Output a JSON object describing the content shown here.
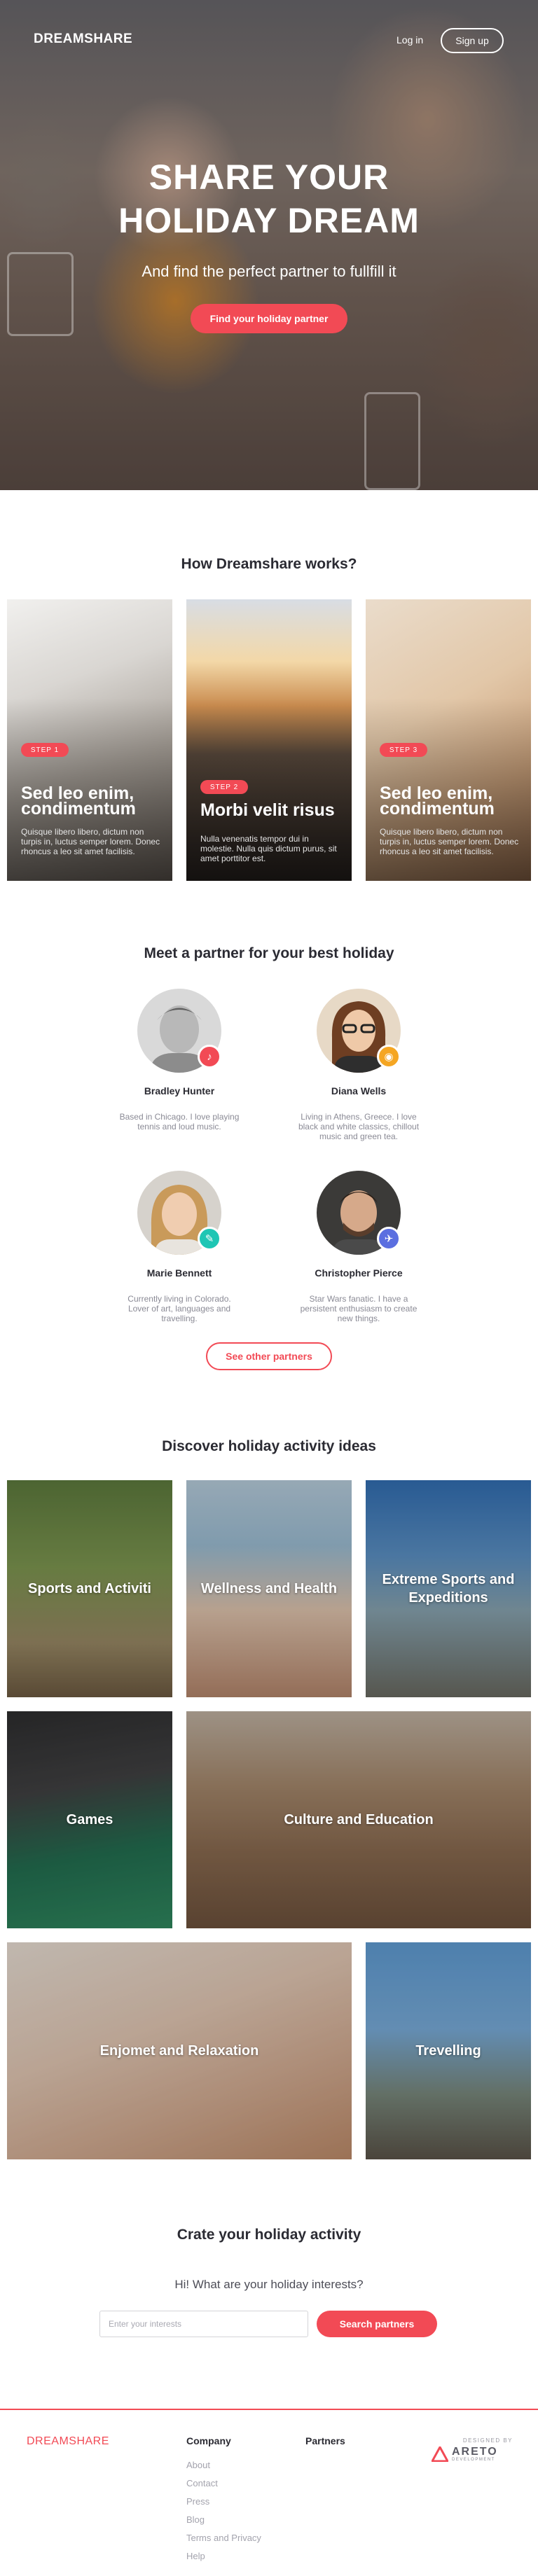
{
  "nav": {
    "brand": "DREAMSHARE",
    "login": "Log in",
    "signup": "Sign up"
  },
  "hero": {
    "title_line1": "SHARE YOUR",
    "title_line2": "HOLIDAY DREAM",
    "subtitle": "And find the perfect partner to fullfill it",
    "cta": "Find your holiday partner"
  },
  "how": {
    "title": "How Dreamshare works?",
    "steps": [
      {
        "badge": "STEP 1",
        "title": "Sed leo enim, condimentum",
        "text": "Quisque libero libero, dictum non turpis in, luctus semper lorem. Donec rhoncus a leo sit amet facilisis."
      },
      {
        "badge": "STEP 2",
        "title": "Morbi velit risus",
        "text": "Nulla venenatis tempor dui in molestie. Nulla quis dictum purus, sit amet porttitor est."
      },
      {
        "badge": "STEP 3",
        "title": "Sed leo enim, condimentum",
        "text": "Quisque libero libero, dictum non turpis in, luctus semper lorem. Donec rhoncus a leo sit amet facilisis."
      }
    ]
  },
  "partners": {
    "title": "Meet a partner for your best holiday",
    "people": [
      {
        "name": "Bradley Hunter",
        "desc": "Based in Chicago. I love playing tennis and loud music.",
        "badge_icon": "music-note-icon",
        "badge_color": "#f24a55"
      },
      {
        "name": "Diana Wells",
        "desc": "Living in Athens, Greece. I love black and white classics, chillout music and green tea.",
        "badge_icon": "camera-icon",
        "badge_color": "#f5a623"
      },
      {
        "name": "Marie Bennett",
        "desc": "Currently living in Colorado. Lover of art, languages and travelling.",
        "badge_icon": "pencil-icon",
        "badge_color": "#1ec6b4"
      },
      {
        "name": "Christopher Pierce",
        "desc": "Star Wars fanatic. I have a persistent enthusiasm to create new things.",
        "badge_icon": "plane-icon",
        "badge_color": "#5b6fe0"
      }
    ],
    "see_other": "See other partners"
  },
  "activities": {
    "title": "Discover holiday activity ideas",
    "items": [
      {
        "label": "Sports and Activiti"
      },
      {
        "label": "Wellness and Health"
      },
      {
        "label": "Extreme Sports and Expeditions"
      },
      {
        "label": "Games"
      },
      {
        "label": "Culture and Education"
      },
      {
        "label": "Enjomet and Relaxation"
      },
      {
        "label": "Trevelling"
      }
    ]
  },
  "create": {
    "title": "Crate your holiday activity",
    "subtitle": "Hi! What are your holiday interests?",
    "placeholder": "Enter your interests",
    "button": "Search partners"
  },
  "footer": {
    "brand": "DREAMSHARE",
    "company_heading": "Company",
    "partners_heading": "Partners",
    "company_links": [
      "About",
      "Contact",
      "Press",
      "Blog",
      "Terms and Privacy",
      "Help"
    ],
    "designed_by": "DESIGNED BY",
    "areto": "ARETO",
    "areto_sub": "DEVELOPMENT"
  },
  "colors": {
    "accent": "#f24a55"
  }
}
